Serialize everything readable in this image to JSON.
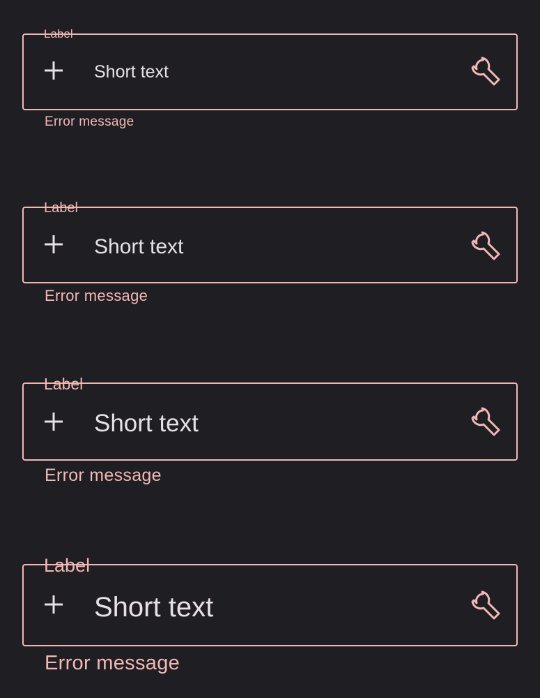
{
  "colors": {
    "background": "#1f1e23",
    "error_accent": "#f2b8b5",
    "text": "#e6e1e5"
  },
  "fields": [
    {
      "label": "Label",
      "value": "Short text",
      "error": "Error message",
      "leading_icon": "plus-icon",
      "trailing_icon": "wrench-icon"
    },
    {
      "label": "Label",
      "value": "Short text",
      "error": "Error message",
      "leading_icon": "plus-icon",
      "trailing_icon": "wrench-icon"
    },
    {
      "label": "Label",
      "value": "Short text",
      "error": "Error message",
      "leading_icon": "plus-icon",
      "trailing_icon": "wrench-icon"
    },
    {
      "label": "Label",
      "value": "Short text",
      "error": "Error message",
      "leading_icon": "plus-icon",
      "trailing_icon": "wrench-icon"
    }
  ]
}
